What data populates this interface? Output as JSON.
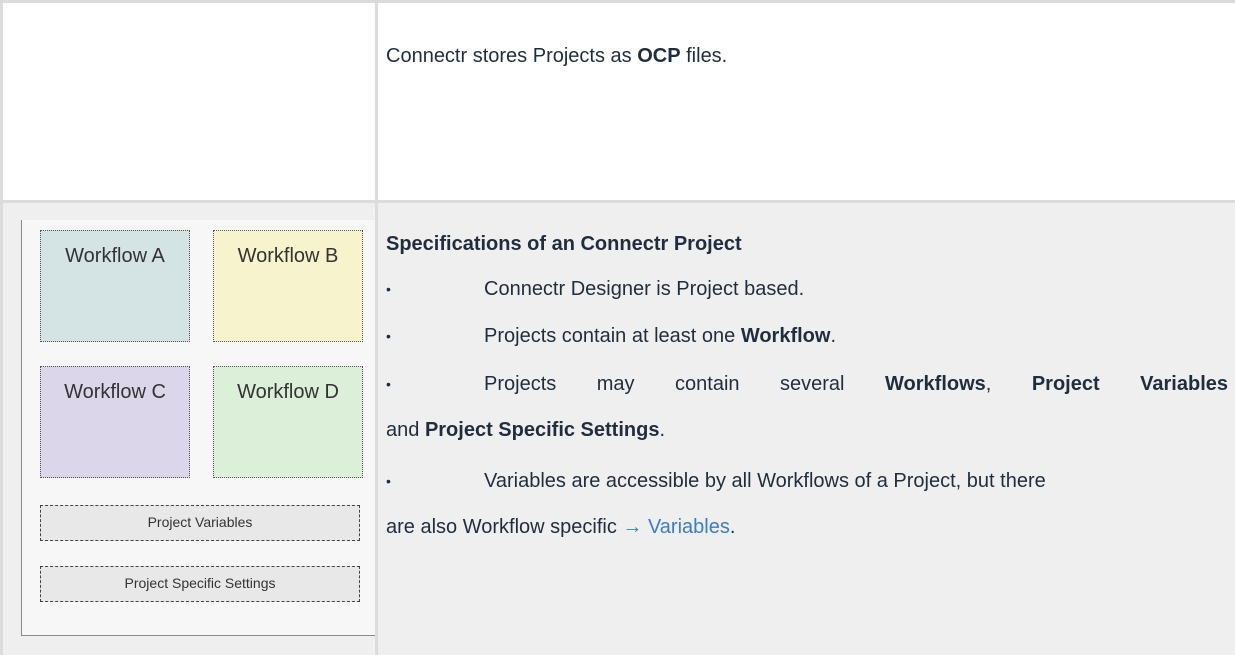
{
  "row1": {
    "intro_prefix": "Connectr stores Projects as ",
    "intro_bold": "OCP",
    "intro_suffix": " files."
  },
  "diagram": {
    "workflows": [
      {
        "label": "Workflow A",
        "color": "#d4e3e3"
      },
      {
        "label": "Workflow B",
        "color": "#f6f3cd"
      },
      {
        "label": "Workflow C",
        "color": "#dcd6eb"
      },
      {
        "label": "Workflow D",
        "color": "#dcefd8"
      }
    ],
    "project_variables": "Project Variables",
    "project_specific_settings": "Project Specific Settings"
  },
  "specs": {
    "heading": "Specifications of an Connectr Project",
    "bullet_symbol": "•",
    "b1": "Connectr Designer is Project based.",
    "b2_prefix": "Projects contain at least one ",
    "b2_bold": "Workflow",
    "b2_suffix": ".",
    "b3_prefix": "Projects may contain several ",
    "b3_bold1": "Workflows",
    "b3_sep": ", ",
    "b3_bold2": "Project Variables",
    "b3_line2_prefix": "and ",
    "b3_line2_bold": "Project Specific Settings",
    "b3_line2_suffix": ".",
    "b4_line1": "Variables are accessible by all Workflows of a Project, but there",
    "b4_line2_prefix": "are also Workflow specific ",
    "b4_link": "→ Variables",
    "b4_line2_suffix": "."
  }
}
